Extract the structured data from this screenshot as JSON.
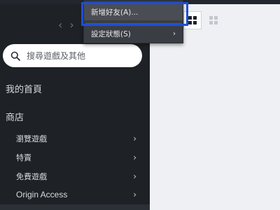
{
  "nav": {
    "back": "‹",
    "forward": "›"
  },
  "search": {
    "placeholder": "搜尋遊戲及其他"
  },
  "sidebar": {
    "home": "我的首頁",
    "store": "商店",
    "store_items": [
      {
        "label": "瀏覽遊戲"
      },
      {
        "label": "特賣"
      },
      {
        "label": "免費遊戲"
      },
      {
        "label": "Origin Access"
      }
    ]
  },
  "context_menu": {
    "items": [
      {
        "label": "新增好友(A)..."
      },
      {
        "label": "設定狀態(S)",
        "submenu_arrow": "›"
      }
    ]
  },
  "view_toggle": {
    "selected": "large-grid"
  },
  "colors": {
    "sidebar_bg": "#1e2126",
    "highlight": "#1d4ed8",
    "menu_bg": "#3a3d43"
  }
}
